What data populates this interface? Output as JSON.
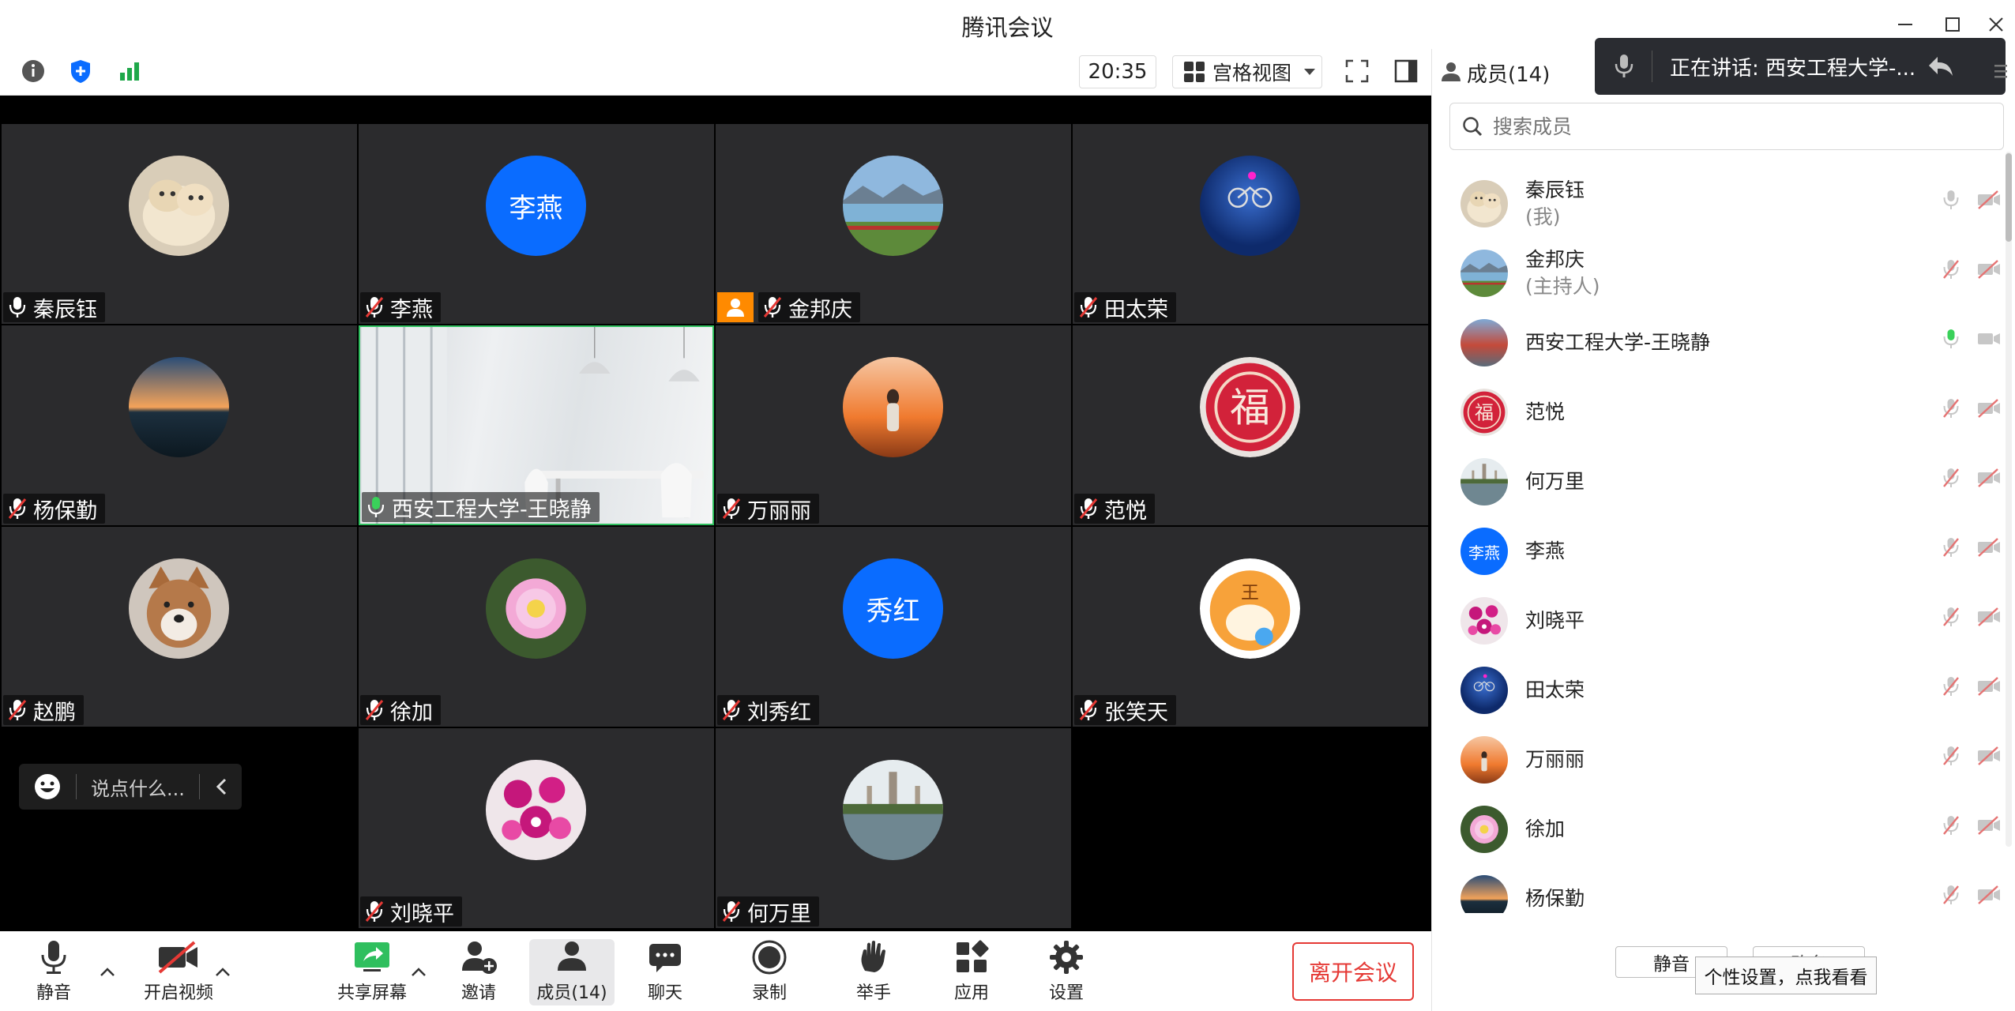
{
  "window": {
    "title": "腾讯会议"
  },
  "toolbar": {
    "time": "20:35",
    "view_label": "宫格视图"
  },
  "tiles": [
    {
      "name": "秦辰钰",
      "mic": "on",
      "avatar": "golden-retriever-photo"
    },
    {
      "name": "李燕",
      "mic": "off",
      "avatar_text": "李燕",
      "avatar_color": "#0a6cff"
    },
    {
      "name": "金邦庆",
      "mic": "off",
      "avatar": "lake-landscape-photo",
      "host": true
    },
    {
      "name": "田太荣",
      "mic": "off",
      "avatar": "cyclist-photo"
    },
    {
      "name": "杨保勤",
      "mic": "off",
      "avatar": "sunset-lake-photo"
    },
    {
      "name": "西安工程大学-王晓静",
      "mic": "on-speaking",
      "video": "white-room-video"
    },
    {
      "name": "万丽丽",
      "mic": "off",
      "avatar": "orange-sunset-girl-photo"
    },
    {
      "name": "范悦",
      "mic": "off",
      "avatar": "fu-character-badge"
    },
    {
      "name": "赵鹏",
      "mic": "off",
      "avatar": "akita-dog-photo"
    },
    {
      "name": "徐加",
      "mic": "off",
      "avatar": "peony-flower-photo"
    },
    {
      "name": "刘秀红",
      "mic": "off",
      "avatar_text": "秀红",
      "avatar_color": "#0a6cff"
    },
    {
      "name": "张笑天",
      "mic": "off",
      "avatar": "cartoon-tiger-photo"
    },
    {
      "name": "刘晓平",
      "mic": "off",
      "avatar": "orchid-flower-photo"
    },
    {
      "name": "何万里",
      "mic": "off",
      "avatar": "pagoda-reflection-photo"
    }
  ],
  "chat_input": {
    "placeholder": "说点什么..."
  },
  "bottom": {
    "mute": "静音",
    "video": "开启视频",
    "share": "共享屏幕",
    "invite": "邀请",
    "members": "成员(14)",
    "chat": "聊天",
    "record": "录制",
    "raise": "举手",
    "apps": "应用",
    "settings": "设置",
    "leave": "离开会议"
  },
  "panel": {
    "title": "成员(14)",
    "speaking": "正在讲话: 西安工程大学-...",
    "search_placeholder": "搜索成员",
    "members": [
      {
        "name": "秦辰钰",
        "sub": "(我)",
        "mic": "on-gray",
        "cam": "off"
      },
      {
        "name": "金邦庆",
        "sub": "(主持人)",
        "mic": "off",
        "cam": "off"
      },
      {
        "name": "西安工程大学-王晓静",
        "sub": "",
        "mic": "on-green",
        "cam": "on"
      },
      {
        "name": "范悦",
        "sub": "",
        "mic": "off",
        "cam": "off"
      },
      {
        "name": "何万里",
        "sub": "",
        "mic": "off",
        "cam": "off"
      },
      {
        "name": "李燕",
        "sub": "",
        "mic": "off",
        "cam": "off",
        "avatar_text": "李燕"
      },
      {
        "name": "刘晓平",
        "sub": "",
        "mic": "off",
        "cam": "off"
      },
      {
        "name": "田太荣",
        "sub": "",
        "mic": "off",
        "cam": "off"
      },
      {
        "name": "万丽丽",
        "sub": "",
        "mic": "off",
        "cam": "off"
      },
      {
        "name": "徐加",
        "sub": "",
        "mic": "off",
        "cam": "off"
      },
      {
        "name": "杨保勤",
        "sub": "",
        "mic": "off",
        "cam": "off"
      }
    ],
    "mute_all": "静音",
    "second_button": "改名",
    "tooltip": "个性设置，点我看看"
  },
  "colors": {
    "accent": "#0a6cff",
    "leave": "#e53935",
    "host_badge": "#ff8a00",
    "speaking_green": "#3ad15a"
  }
}
